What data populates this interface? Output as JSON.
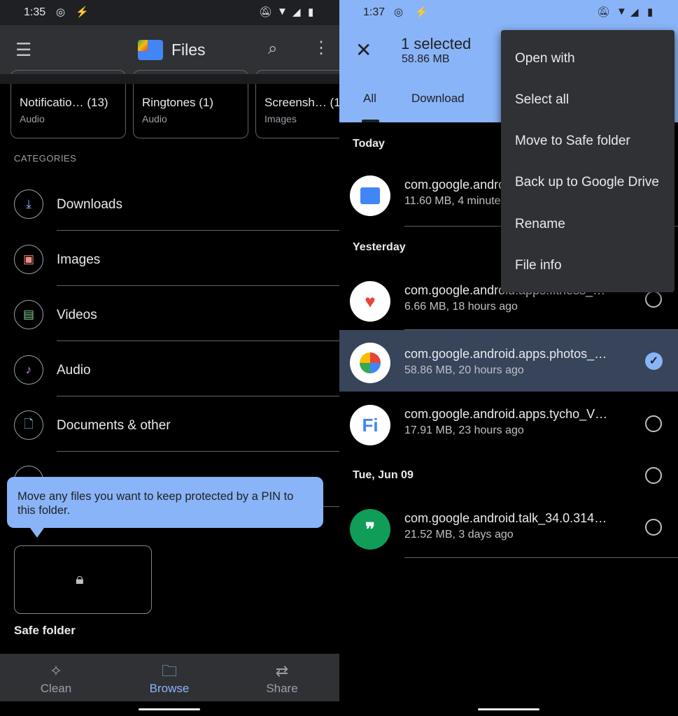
{
  "left": {
    "status": {
      "time": "1:35"
    },
    "appbar": {
      "title": "Files",
      "logo_colors": [
        "#4285f4",
        "#fbbc04",
        "#ea4335",
        "#34a853"
      ]
    },
    "cards": [
      {
        "name": "Notificatio… (13)",
        "sub": "Audio"
      },
      {
        "name": "Ringtones (1)",
        "sub": "Audio"
      },
      {
        "name": "Screensh…  (1",
        "sub": "Images"
      }
    ],
    "categories_label": "CATEGORIES",
    "categories": [
      {
        "label": "Downloads",
        "icon": "download-icon",
        "color": "#8ab4f8"
      },
      {
        "label": "Images",
        "icon": "image-icon",
        "color": "#f28b82"
      },
      {
        "label": "Videos",
        "icon": "video-icon",
        "color": "#81c995"
      },
      {
        "label": "Audio",
        "icon": "music-note-icon",
        "color": "#c58af9"
      },
      {
        "label": "Documents & other",
        "icon": "document-icon",
        "color": "#78d9ec"
      }
    ],
    "tooltip": "Move any files you want to keep protected by a PIN to this folder.",
    "safe_folder": {
      "label": "Safe folder"
    },
    "bottom_nav": [
      {
        "label": "Clean",
        "icon": "sparkle-icon"
      },
      {
        "label": "Browse",
        "icon": "browse-folder-icon",
        "active": true
      },
      {
        "label": "Share",
        "icon": "swap-arrows-icon"
      }
    ],
    "accent": "#8ab4f8"
  },
  "right": {
    "status": {
      "time": "1:37"
    },
    "header": {
      "title": "1 selected",
      "size": "58.86 MB"
    },
    "tabs": [
      {
        "label": "All",
        "active": true
      },
      {
        "label": "Download"
      }
    ],
    "menu": [
      "Open with",
      "Select all",
      "Move to Safe folder",
      "Back up to Google Drive",
      "Rename",
      "File info"
    ],
    "sections": {
      "today": "Today",
      "yesterday": "Yesterday",
      "jun09": "Tue, Jun 09"
    },
    "files": [
      {
        "name": "com.google.android.apps.nbu.files",
        "meta": "11.60 MB, 4 minutes ago",
        "selected": false
      },
      {
        "name": "com.google.android.apps.fitness_…",
        "meta": "6.66 MB, 18 hours ago",
        "selected": false
      },
      {
        "name": "com.google.android.apps.photos_…",
        "meta": "58.86 MB, 20 hours ago",
        "selected": true
      },
      {
        "name": "com.google.android.apps.tycho_V…",
        "meta": "17.91 MB, 23 hours ago",
        "selected": false
      },
      {
        "name": "com.google.android.talk_34.0.314…",
        "meta": "21.52 MB, 3 days ago",
        "selected": false
      }
    ],
    "selection_color": "#8ab4f8"
  }
}
